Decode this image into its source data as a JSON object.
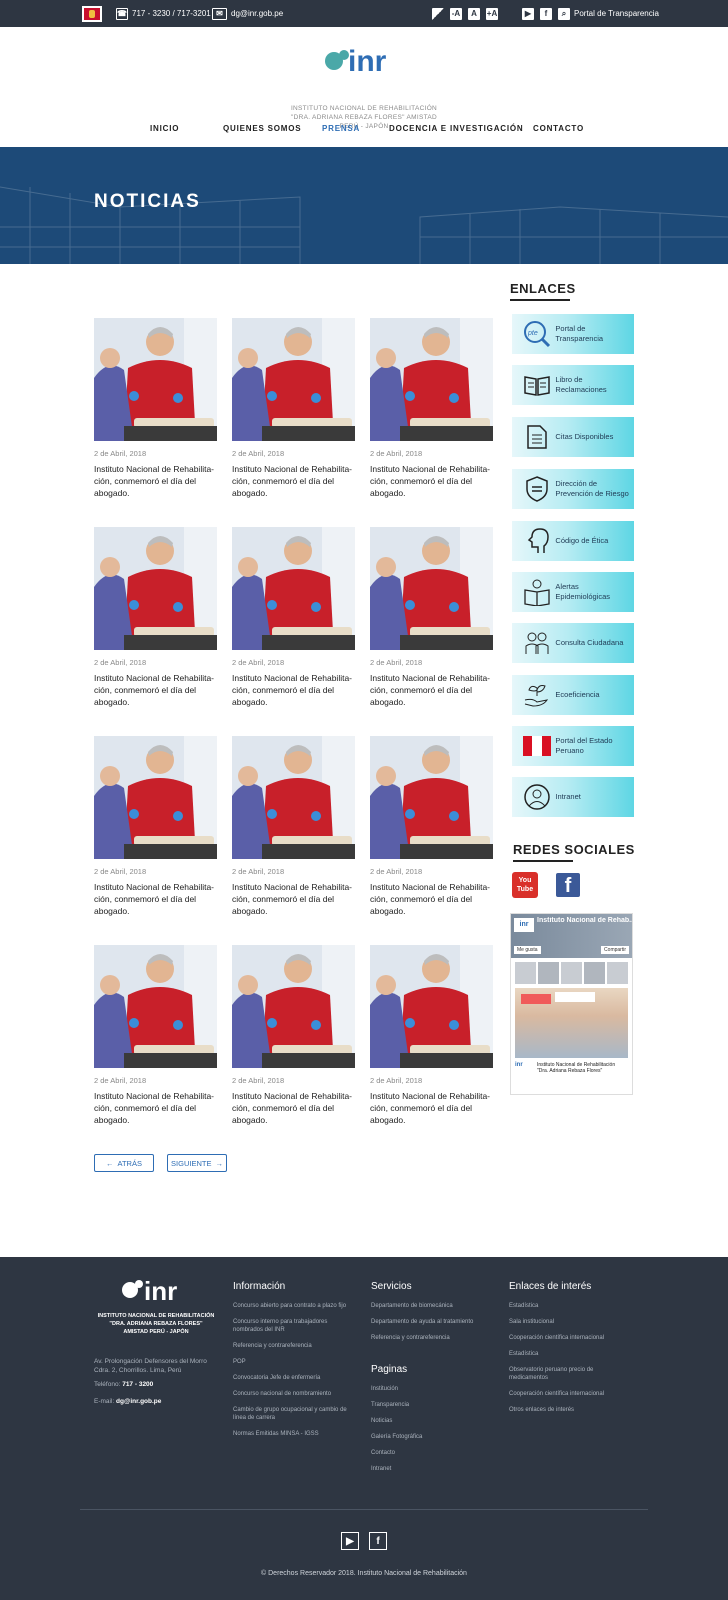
{
  "topbar": {
    "phone": "717 - 3230 / 717-3201",
    "email": "dg@inr.gob.pe",
    "font_small": "-A",
    "font_normal": "A",
    "font_large": "+A",
    "transparency": "Portal de Transparencia"
  },
  "header": {
    "logo_text": "inr",
    "line1": "INSTITUTO NACIONAL DE REHABILITACIÓN",
    "line2": "\"DRA. ADRIANA REBAZA FLORES\" AMISTAD",
    "line3": "PERÚ - JAPÓN"
  },
  "nav": [
    {
      "label": "INICIO"
    },
    {
      "label": "QUIENES SOMOS"
    },
    {
      "label": "PRENSA"
    },
    {
      "label": "DOCENCIA E INVESTIGACIÓN"
    },
    {
      "label": "CONTACTO"
    }
  ],
  "banner": {
    "title": "NOTICIAS"
  },
  "news": [
    {
      "date": "2 de Abril, 2018",
      "title": "Instituto Nacional de Rehabilita-ción, conmemoró el día del abogado."
    },
    {
      "date": "2 de Abril, 2018",
      "title": "Instituto Nacional de Rehabilita-ción, conmemoró el día del abogado."
    },
    {
      "date": "2 de Abril, 2018",
      "title": "Instituto Nacional de Rehabilita-ción, conmemoró el día del abogado."
    },
    {
      "date": "2 de Abril, 2018",
      "title": "Instituto Nacional de Rehabilita-ción, conmemoró el día del abogado."
    },
    {
      "date": "2 de Abril, 2018",
      "title": "Instituto Nacional de Rehabilita-ción, conmemoró el día del abogado."
    },
    {
      "date": "2 de Abril, 2018",
      "title": "Instituto Nacional de Rehabilita-ción, conmemoró el día del abogado."
    },
    {
      "date": "2 de Abril, 2018",
      "title": "Instituto Nacional de Rehabilita-ción, conmemoró el día del abogado."
    },
    {
      "date": "2 de Abril, 2018",
      "title": "Instituto Nacional de Rehabilita-ción, conmemoró el día del abogado."
    },
    {
      "date": "2 de Abril, 2018",
      "title": "Instituto Nacional de Rehabilita-ción, conmemoró el día del abogado."
    },
    {
      "date": "2 de Abril, 2018",
      "title": "Instituto Nacional de Rehabilita-ción, conmemoró el día del abogado."
    },
    {
      "date": "2 de Abril, 2018",
      "title": "Instituto Nacional de Rehabilita-ción, conmemoró el día del abogado."
    },
    {
      "date": "2 de Abril, 2018",
      "title": "Instituto Nacional de Rehabilita-ción, conmemoró el día del abogado."
    }
  ],
  "pager": {
    "prev": "ATRÁS",
    "next": "SIGUIENTE"
  },
  "sidebar": {
    "links_title": "ENLACES",
    "links": [
      {
        "label": "Portal de Transparencia",
        "icon": "pte-icon"
      },
      {
        "label": "Libro de Reclamaciones",
        "icon": "book-icon"
      },
      {
        "label": "Citas Disponibles",
        "icon": "document-icon"
      },
      {
        "label": "Dirección de Prevención de Riesgo",
        "icon": "shield-icon"
      },
      {
        "label": "Código de Ética",
        "icon": "head-icon"
      },
      {
        "label": "Alertas Epidemiológicas",
        "icon": "reading-icon"
      },
      {
        "label": "Consulta Ciudadana",
        "icon": "people-icon"
      },
      {
        "label": "Ecoeficiencia",
        "icon": "plant-hand-icon"
      },
      {
        "label": "Portal del Estado Peruano",
        "icon": "peru-flag-icon"
      },
      {
        "label": "Intranet",
        "icon": "user-circle-icon"
      }
    ],
    "social_title": "REDES SOCIALES",
    "youtube": "You Tube",
    "fb_widget": {
      "page_name": "Instituto Nacional de Rehab...",
      "like": "Me gusta",
      "share": "Compartir",
      "post_name": "Instituto Nacional de Rehabilitación \"Dra. Adriana Rebaza Flores\""
    }
  },
  "footer": {
    "logo_text": "inr",
    "org1": "INSTITUTO NACIONAL DE REHABILITACIÓN",
    "org2": "\"DRA. ADRIANA REBAZA FLORES\"",
    "org3": "AMISTAD PERÚ - JAPÓN",
    "address": "Av. Prolongación Defensores del Morro Cdra. 2, Chorrillos. Lima, Perú",
    "phone_label": "Teléfono:",
    "phone": "717 - 3200",
    "email_label": "E-mail:",
    "email": "dg@inr.gob.pe",
    "info_title": "Información",
    "info": [
      "Concurso abierto para contrato a plazo fijo",
      "Concurso interno para trabajadores nombrados del INR",
      "Referencia y contrareferencia",
      "POP",
      "Convocatoria Jefe de enfermería",
      "Concurso nacional de nombramiento",
      "Cambio de grupo ocupacional y cambio de línea de carrera",
      "Normas Emitidas MINSA - IGSS"
    ],
    "services_title": "Servicios",
    "services": [
      "Departamento de biomecánica",
      "Departamento de ayuda al tratamiento",
      "Referencia y contrareferencia"
    ],
    "pages_title": "Paginas",
    "pages": [
      "Institución",
      "Transparencia",
      "Noticias",
      "Galería Fotográfica",
      "Contacto",
      "Intranet"
    ],
    "links_title": "Enlaces de interés",
    "links": [
      "Estadística",
      "Sala institucional",
      "Cooperación científica internacional",
      "Estadística",
      "Observatorio peruano precio de medicamentos",
      "Cooperación científica internacional",
      "Otros enlaces de interés"
    ],
    "copyright": "© Derechos Reservador 2018. Instituto Nacional de Rehabilitación"
  },
  "colors": {
    "brand": "#2e3642",
    "banner": "#1d4a78",
    "accent": "#2e6db4",
    "teal": "#5ed6e4",
    "logo": "#4aa8a8"
  }
}
